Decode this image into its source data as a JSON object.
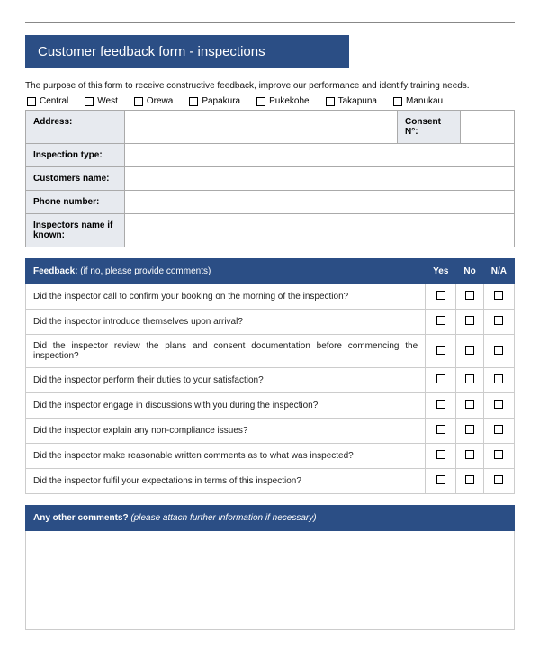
{
  "title": "Customer feedback form - inspections",
  "purpose": "The purpose of this form to receive constructive feedback, improve our performance and identify training needs.",
  "locations": [
    "Central",
    "West",
    "Orewa",
    "Papakura",
    "Pukekohe",
    "Takapuna",
    "Manukau"
  ],
  "info": {
    "address_label": "Address:",
    "consent_label": "Consent N°:",
    "inspection_type_label": "Inspection type:",
    "customers_name_label": "Customers name:",
    "phone_label": "Phone number:",
    "inspectors_name_label": "Inspectors name if known:"
  },
  "feedback": {
    "header_main": "Feedback:",
    "header_note": " (if no, please provide comments)",
    "col_yes": "Yes",
    "col_no": "No",
    "col_na": "N/A",
    "questions": [
      "Did the inspector call to confirm your booking on the morning of the inspection?",
      "Did the inspector introduce themselves upon arrival?",
      "Did the inspector review the plans and consent documentation before commencing the inspection?",
      "Did the inspector perform their duties to your satisfaction?",
      "Did the inspector engage in discussions with you during the inspection?",
      "Did the inspector explain any non-compliance issues?",
      "Did the inspector make reasonable written comments as to what was inspected?",
      "Did the inspector fulfil your expectations in terms of this inspection?"
    ]
  },
  "comments": {
    "label_bold": "Any other comments?",
    "label_italic": " (please attach further information if necessary)"
  }
}
